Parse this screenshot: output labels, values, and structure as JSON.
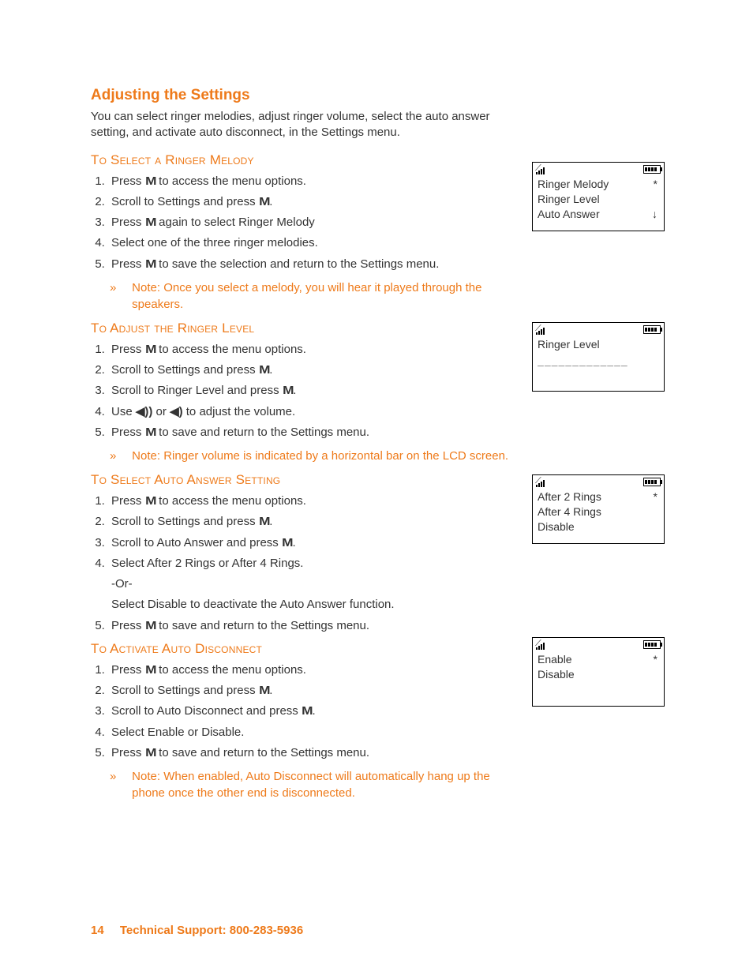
{
  "title": "Adjusting the Settings",
  "intro": "You can select ringer melodies, adjust ringer volume, select the auto answer setting, and activate auto disconnect, in the Settings menu.",
  "sectionA": {
    "heading": "To Select a Ringer Melody",
    "s1a": "Press ",
    "s1b": " to access the menu options.",
    "s2a": "Scroll to Settings and press ",
    "s2b": ".",
    "s3a": "Press ",
    "s3b": " again to select Ringer Melody",
    "s4": "Select one of the three ringer melodies.",
    "s5a": "Press ",
    "s5b": " to save the selection and return to the Settings menu.",
    "note": "Note: Once you select a melody, you will hear it played through the speakers."
  },
  "sectionB": {
    "heading": "To Adjust the Ringer Level",
    "s1a": "Press ",
    "s1b": " to access the menu options.",
    "s2a": "Scroll to Settings and press ",
    "s2b": ".",
    "s3a": "Scroll to Ringer Level and press ",
    "s3b": ".",
    "s4a": "Use ",
    "s4b": " or ",
    "s4c": " to adjust the volume.",
    "s5a": "Press ",
    "s5b": " to save and return to the Settings menu.",
    "note": "Note: Ringer volume is indicated by a horizontal bar on the LCD screen."
  },
  "sectionC": {
    "heading": "To Select Auto Answer Setting",
    "s1a": "Press ",
    "s1b": " to access the menu options.",
    "s2a": "Scroll to Settings and press ",
    "s2b": ".",
    "s3a": "Scroll to Auto Answer and press ",
    "s3b": ".",
    "s4": "Select After 2 Rings or After 4 Rings.",
    "s4or": "-Or-",
    "s4alt": "Select Disable to deactivate the Auto Answer function.",
    "s5a": "Press ",
    "s5b": " to save and return to the Settings menu."
  },
  "sectionD": {
    "heading": "To Activate Auto Disconnect",
    "s1a": "Press ",
    "s1b": " to access the menu options.",
    "s2a": "Scroll to Settings and press ",
    "s2b": ".",
    "s3a": "Scroll to Auto Disconnect and press ",
    "s3b": ".",
    "s4": "Select Enable or Disable.",
    "s5a": "Press ",
    "s5b": " to save and return to the Settings menu.",
    "note": "Note: When enabled, Auto Disconnect will automatically hang up the phone once the other end is disconnected."
  },
  "lcd1": {
    "r1": "Ringer Melody",
    "r2": "Ringer Level",
    "r3": "Auto Answer"
  },
  "lcd2": {
    "r1": "Ringer Level",
    "bar": "_____________"
  },
  "lcd3": {
    "r1": "After 2 Rings",
    "r2": "After 4 Rings",
    "r3": "Disable"
  },
  "lcd4": {
    "r1": "Enable",
    "r2": "Disable"
  },
  "icons": {
    "m": "M",
    "chev": "»",
    "star": "*",
    "down": "↓",
    "volUp": "◀))",
    "volDn": "◀)"
  },
  "footer": {
    "page": "14",
    "label": "Technical Support:   800-283-5936"
  }
}
